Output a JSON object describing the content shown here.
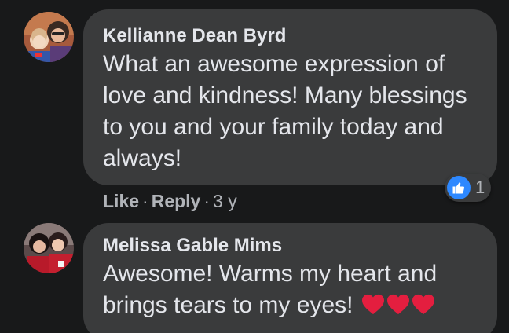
{
  "comments": [
    {
      "author": "Kellianne Dean Byrd",
      "lines": [
        "What an awesome expression of",
        "love and kindness! Many blessings",
        "to you and your family today and",
        "always!"
      ],
      "actions": {
        "like_label": "Like",
        "separator": "·",
        "reply_label": "Reply",
        "timestamp": "3 y"
      },
      "reaction": {
        "icon": "thumbs-up-icon",
        "count": "1",
        "color": "#2d88ff"
      }
    },
    {
      "author": "Melissa Gable Mims",
      "lines": [
        "Awesome! Warms my heart and",
        "brings tears to my eyes!"
      ],
      "emojis": [
        "red-heart-icon",
        "red-heart-icon",
        "red-heart-icon"
      ]
    }
  ],
  "colors": {
    "background": "#18191a",
    "bubble": "#3a3b3c",
    "text": "#e4e6eb",
    "secondary_text": "#b0b3b8",
    "like_blue": "#2d88ff",
    "heart_red": "#e41e3f"
  }
}
